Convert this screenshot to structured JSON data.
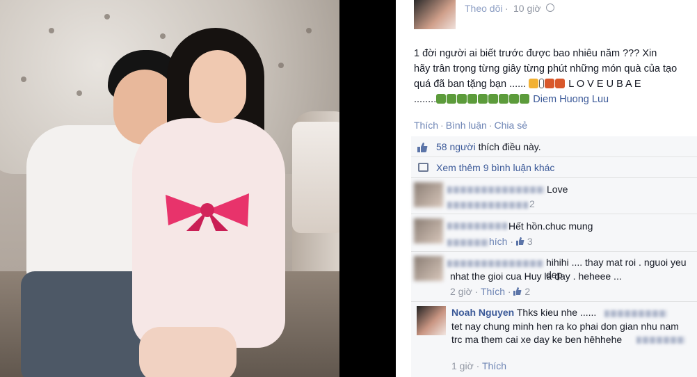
{
  "post": {
    "follow_label": "Theo dõi",
    "dot": "·",
    "time": "10 giờ",
    "icon": "globe-icon",
    "text_line1": "1 đời người ai biết trước được bao nhiêu năm ??? Xin",
    "text_line2": "hãy trân trọng từng giây từng phút những món quà của tạo",
    "text_line3a": "quá đã ban tặng bạn ...... ",
    "text_line3b": " L O V E U B A E",
    "text_line4a": "........",
    "tagged_name": "Diem Huong Luu",
    "like_action": "Thích",
    "comment_action": "Bình luận",
    "share_action": "Chia sẻ",
    "sep": "·"
  },
  "ufi": {
    "likes_count": "58 người",
    "likes_suffix": " thích điều này.",
    "view_more": "Xem thêm 9 bình luận khác"
  },
  "comments": [
    {
      "text": "Love",
      "meta_likes": "2"
    },
    {
      "text": "Hết hồn.chuc mung",
      "like_label": "hích",
      "meta_likes": "3"
    },
    {
      "text_line1": "hihihi .... thay mat roi . nguoi yeu dep",
      "text_line2": "nhat the gioi cua Huy la đay . heheee ...",
      "time": "2 giờ",
      "like_label": "Thích",
      "meta_likes": "2"
    },
    {
      "author": "Noah Nguyen",
      "text_line1": "Thks kieu nhe ......",
      "text_line2": "tet nay chung minh hen ra ko phai don gian nhu nam",
      "text_line3": "trc ma them cai xe day ke ben hêhhehe",
      "time": "1 giờ",
      "like_label": "Thích"
    }
  ],
  "colors": {
    "link": "#3b5998",
    "muted": "#9197a3",
    "action": "#6d84b4"
  }
}
